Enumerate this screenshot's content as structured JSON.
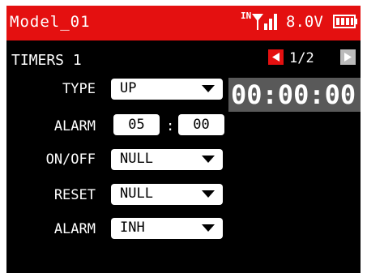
{
  "header": {
    "model_name": "Model_01",
    "signal_label": "IN",
    "voltage": "8.0V",
    "accent_color": "#e41010"
  },
  "screen": {
    "title": "TIMERS 1",
    "page": "1/2"
  },
  "fields": {
    "type": {
      "label": "TYPE",
      "value": "UP"
    },
    "alarm_time": {
      "label": "ALARM",
      "minutes": "05",
      "separator": ":",
      "seconds": "00"
    },
    "on_off": {
      "label": "ON/OFF",
      "value": "NULL"
    },
    "reset": {
      "label": "RESET",
      "value": "NULL"
    },
    "alarm": {
      "label": "ALARM",
      "value": "INH"
    }
  },
  "timer": {
    "display": "00:00:00"
  },
  "icons": [
    "signal-icon",
    "battery-icon",
    "arrow-left-icon",
    "arrow-right-icon",
    "chevron-down-icon"
  ]
}
